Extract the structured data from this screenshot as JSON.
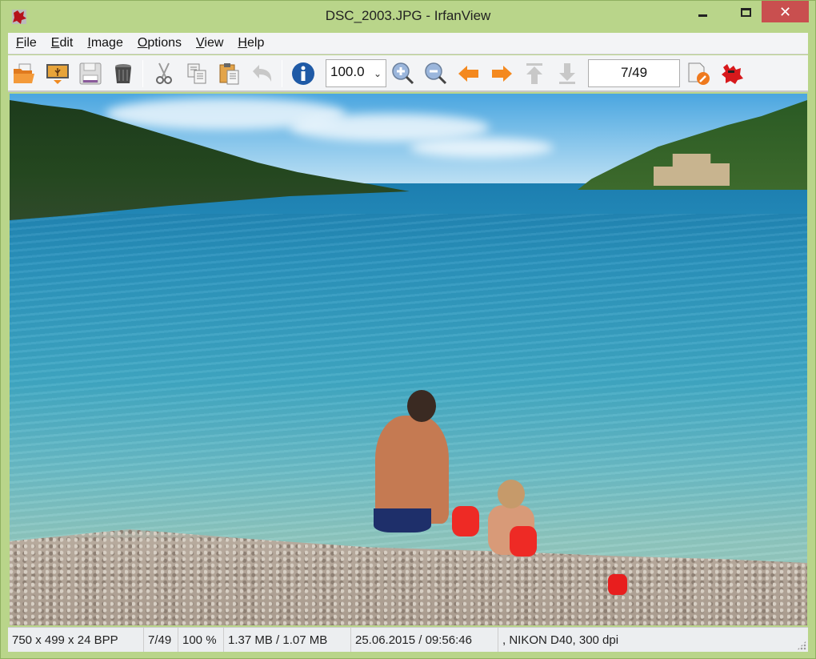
{
  "window": {
    "title": "DSC_2003.JPG - IrfanView",
    "controls": {
      "minimize": "–",
      "maximize": "□",
      "close": "✕"
    },
    "accent_color": "#b9d58a",
    "close_color": "#c94f4f"
  },
  "menu": {
    "items": [
      {
        "label": "File",
        "mnemonic": "F"
      },
      {
        "label": "Edit",
        "mnemonic": "E"
      },
      {
        "label": "Image",
        "mnemonic": "I"
      },
      {
        "label": "Options",
        "mnemonic": "O"
      },
      {
        "label": "View",
        "mnemonic": "V"
      },
      {
        "label": "Help",
        "mnemonic": "H"
      }
    ]
  },
  "toolbar": {
    "buttons": [
      {
        "name": "open",
        "icon": "folder-open-icon"
      },
      {
        "name": "slideshow",
        "icon": "slideshow-icon"
      },
      {
        "name": "save",
        "icon": "floppy-save-icon"
      },
      {
        "name": "delete",
        "icon": "trash-icon"
      },
      {
        "name": "cut",
        "icon": "scissors-icon",
        "disabled": true
      },
      {
        "name": "copy",
        "icon": "copy-icon"
      },
      {
        "name": "paste",
        "icon": "clipboard-paste-icon"
      },
      {
        "name": "undo",
        "icon": "undo-arrow-icon",
        "disabled": true
      },
      {
        "name": "properties",
        "icon": "info-icon"
      },
      {
        "name": "zoom-in",
        "icon": "zoom-in-icon"
      },
      {
        "name": "zoom-out",
        "icon": "zoom-out-icon"
      },
      {
        "name": "previous",
        "icon": "arrow-left-icon"
      },
      {
        "name": "next",
        "icon": "arrow-right-icon"
      },
      {
        "name": "first",
        "icon": "arrow-first-icon",
        "disabled": true
      },
      {
        "name": "last",
        "icon": "arrow-last-icon",
        "disabled": true
      },
      {
        "name": "plugins-settings",
        "icon": "settings-wrench-icon"
      },
      {
        "name": "about",
        "icon": "irfanview-logo-icon"
      }
    ],
    "zoom_value": "100.0",
    "page_indicator": "7/49"
  },
  "image": {
    "description": "Beach photo: father and child sitting by clear blue sea with wooded hills"
  },
  "status": {
    "dimensions": "750 x 499 x 24 BPP",
    "index": "7/49",
    "zoom": "100 %",
    "size": "1.37 MB / 1.07 MB",
    "datetime": "25.06.2015 / 09:56:46",
    "exif": ", NIKON D40, 300 dpi"
  }
}
